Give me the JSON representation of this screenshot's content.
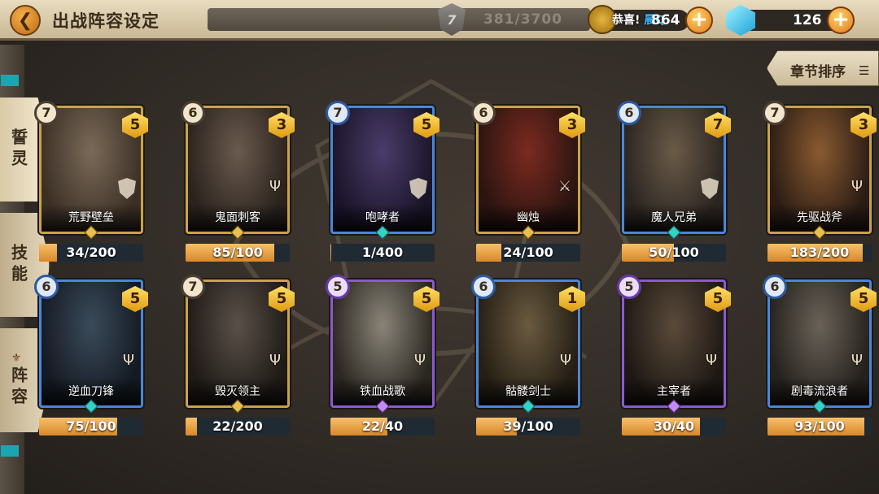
{
  "header": {
    "back_icon": "back-arrow-icon",
    "title": "出战阵容设定",
    "stamina": {
      "icon": "stamina-shield-icon",
      "level_badge": "7",
      "value": "381/3700"
    },
    "notice": {
      "prefix": "恭喜!",
      "highlight": "晨Q",
      "suffix": ""
    },
    "coins": {
      "icon": "gold-coin-icon",
      "value": "864"
    },
    "gems": {
      "icon": "blue-gem-icon",
      "value": "126"
    }
  },
  "sort": {
    "label": "章节排序",
    "icon": "list-icon"
  },
  "tabs": [
    {
      "label": "誓灵",
      "active": true
    },
    {
      "label": "技能",
      "active": false
    },
    {
      "label": "阵容",
      "icon": "lineup-icon",
      "active": false
    }
  ],
  "cards": [
    {
      "name": "荒野壁垒",
      "cost": "7",
      "stars": "5",
      "progress": "34/200",
      "fill": 0.17,
      "frame": "gold",
      "role_icon": "shield-icon",
      "art": [
        "#7a6a58",
        "#3b2f25"
      ]
    },
    {
      "name": "鬼面刺客",
      "cost": "6",
      "stars": "3",
      "progress": "85/100",
      "fill": 0.85,
      "frame": "gold",
      "role_icon": "trident-icon",
      "art": [
        "#6a5a4e",
        "#2a221c"
      ]
    },
    {
      "name": "咆哮者",
      "cost": "7",
      "stars": "5",
      "progress": "1/400",
      "fill": 0.0025,
      "frame": "blue",
      "role_icon": "shield-icon",
      "art": [
        "#4a3c6a",
        "#1a1428"
      ]
    },
    {
      "name": "幽烛",
      "cost": "6",
      "stars": "3",
      "progress": "24/100",
      "fill": 0.24,
      "frame": "gold",
      "role_icon": "sword-icon",
      "art": [
        "#7a2a20",
        "#2a1410"
      ]
    },
    {
      "name": "魔人兄弟",
      "cost": "6",
      "stars": "7",
      "progress": "50/100",
      "fill": 0.5,
      "frame": "blue",
      "role_icon": "shield-icon",
      "art": [
        "#6a5a48",
        "#2a2420"
      ]
    },
    {
      "name": "先驱战斧",
      "cost": "7",
      "stars": "3",
      "progress": "183/200",
      "fill": 0.915,
      "frame": "gold",
      "role_icon": "trident-icon",
      "art": [
        "#8a5a30",
        "#2a1c14"
      ]
    },
    {
      "name": "逆血刀锋",
      "cost": "6",
      "stars": "5",
      "progress": "75/100",
      "fill": 0.75,
      "frame": "blue",
      "role_icon": "trident-icon",
      "art": [
        "#3a4a5a",
        "#141a22"
      ]
    },
    {
      "name": "毁灭领主",
      "cost": "7",
      "stars": "5",
      "progress": "22/200",
      "fill": 0.11,
      "frame": "gold",
      "role_icon": "trident-icon",
      "art": [
        "#5a5048",
        "#1e1a16"
      ]
    },
    {
      "name": "铁血战歌",
      "cost": "5",
      "stars": "5",
      "progress": "22/40",
      "fill": 0.55,
      "frame": "purple",
      "role_icon": "trident-icon",
      "art": [
        "#8a8478",
        "#2a2620"
      ]
    },
    {
      "name": "骷髅剑士",
      "cost": "6",
      "stars": "1",
      "progress": "39/100",
      "fill": 0.39,
      "frame": "blue",
      "role_icon": "trident-icon",
      "art": [
        "#6a5a40",
        "#241e14"
      ]
    },
    {
      "name": "主宰者",
      "cost": "5",
      "stars": "5",
      "progress": "30/40",
      "fill": 0.75,
      "frame": "purple",
      "role_icon": "trident-icon",
      "art": [
        "#5a4a3a",
        "#1e1814"
      ]
    },
    {
      "name": "剧毒流浪者",
      "cost": "6",
      "stars": "5",
      "progress": "93/100",
      "fill": 0.93,
      "frame": "blue",
      "role_icon": "trident-icon",
      "art": [
        "#6a6258",
        "#24201c"
      ]
    }
  ],
  "colors": {
    "gold": "#c9a24a",
    "blue": "#4a86d8",
    "purple": "#8a5ad0",
    "progress_fill": "#e39a3a",
    "accent_teal": "#19a6b0"
  }
}
